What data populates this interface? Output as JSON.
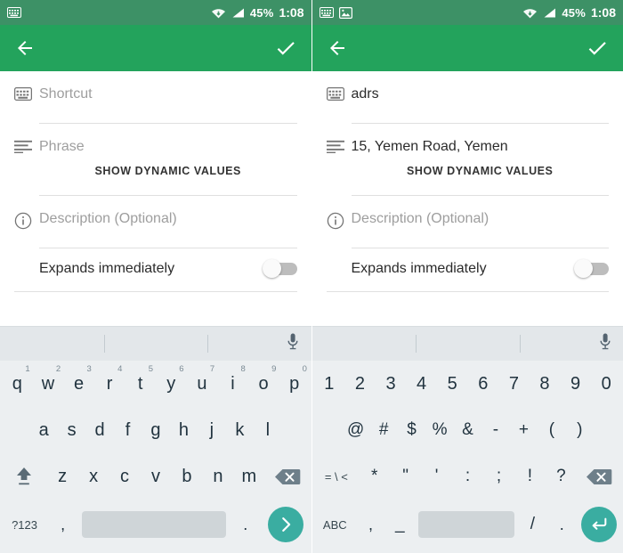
{
  "screens": [
    {
      "id": "empty-form",
      "status_bar": {
        "icons": [
          "keyboard-icon"
        ],
        "wifi": "wifi-icon",
        "signal": "signal-icon",
        "battery_percent": "45%",
        "time": "1:08"
      },
      "app_bar": {
        "back_icon": "back-arrow-icon",
        "confirm_icon": "check-icon"
      },
      "form": {
        "shortcut": {
          "icon": "keyboard-icon",
          "value": "",
          "placeholder": "Shortcut"
        },
        "phrase": {
          "icon": "phrase-lines-icon",
          "value": "",
          "placeholder": "Phrase"
        },
        "dynamic_values_button": "SHOW DYNAMIC VALUES",
        "description": {
          "icon": "info-icon",
          "value": "",
          "placeholder": "Description (Optional)"
        },
        "expands": {
          "label": "Expands immediately",
          "state": "off"
        }
      },
      "keyboard": {
        "mode": "letters",
        "mic_icon": "microphone-icon",
        "suggestions": [
          "",
          "",
          ""
        ],
        "row1": [
          {
            "key": "q",
            "hint": "1"
          },
          {
            "key": "w",
            "hint": "2"
          },
          {
            "key": "e",
            "hint": "3"
          },
          {
            "key": "r",
            "hint": "4"
          },
          {
            "key": "t",
            "hint": "5"
          },
          {
            "key": "y",
            "hint": "6"
          },
          {
            "key": "u",
            "hint": "7"
          },
          {
            "key": "i",
            "hint": "8"
          },
          {
            "key": "o",
            "hint": "9"
          },
          {
            "key": "p",
            "hint": "0"
          }
        ],
        "row2": [
          "a",
          "s",
          "d",
          "f",
          "g",
          "h",
          "j",
          "k",
          "l"
        ],
        "row3": {
          "shift_icon": "shift-arrow-icon",
          "keys": [
            "z",
            "x",
            "c",
            "v",
            "b",
            "n",
            "m"
          ],
          "backspace_icon": "backspace-icon"
        },
        "row4": {
          "mode_switch": "?123",
          "comma": ",",
          "space": "",
          "period": ".",
          "action_icon": "next-arrow-icon"
        }
      }
    },
    {
      "id": "filled-form",
      "status_bar": {
        "icons": [
          "keyboard-icon",
          "image-icon"
        ],
        "wifi": "wifi-icon",
        "signal": "signal-icon",
        "battery_percent": "45%",
        "time": "1:08"
      },
      "app_bar": {
        "back_icon": "back-arrow-icon",
        "confirm_icon": "check-icon"
      },
      "form": {
        "shortcut": {
          "icon": "keyboard-icon",
          "value": "adrs",
          "placeholder": "Shortcut"
        },
        "phrase": {
          "icon": "phrase-lines-icon",
          "value": "15, Yemen Road, Yemen",
          "placeholder": "Phrase"
        },
        "dynamic_values_button": "SHOW DYNAMIC VALUES",
        "description": {
          "icon": "info-icon",
          "value": "",
          "placeholder": "Description (Optional)"
        },
        "expands": {
          "label": "Expands immediately",
          "state": "off"
        }
      },
      "keyboard": {
        "mode": "symbols",
        "mic_icon": "microphone-icon",
        "suggestions": [
          "",
          "",
          ""
        ],
        "row1": [
          {
            "key": "1",
            "hint": ""
          },
          {
            "key": "2",
            "hint": ""
          },
          {
            "key": "3",
            "hint": ""
          },
          {
            "key": "4",
            "hint": ""
          },
          {
            "key": "5",
            "hint": ""
          },
          {
            "key": "6",
            "hint": ""
          },
          {
            "key": "7",
            "hint": ""
          },
          {
            "key": "8",
            "hint": ""
          },
          {
            "key": "9",
            "hint": ""
          },
          {
            "key": "0",
            "hint": ""
          }
        ],
        "row2": [
          "@",
          "#",
          "$",
          "%",
          "&",
          "-",
          "+",
          "(",
          ")"
        ],
        "row3": {
          "more_symbols": "= \\ <",
          "keys": [
            "*",
            "\"",
            "'",
            ":",
            ";",
            "!",
            "?"
          ],
          "backspace_icon": "backspace-icon"
        },
        "row4": {
          "mode_switch": "ABC",
          "comma": ",",
          "underscore": "_",
          "space": "",
          "slash": "/",
          "period": ".",
          "action_icon": "enter-return-icon"
        }
      }
    }
  ],
  "colors": {
    "status_bar": "#3d9166",
    "app_bar": "#23a35c",
    "keyboard_bg": "#eceff1",
    "suggestion_bg": "#e3e7ea",
    "action_key": "#3aada1",
    "spacebar": "#cfd5d8",
    "placeholder_text": "#9e9e9e",
    "primary_text": "#2b2b2b"
  }
}
